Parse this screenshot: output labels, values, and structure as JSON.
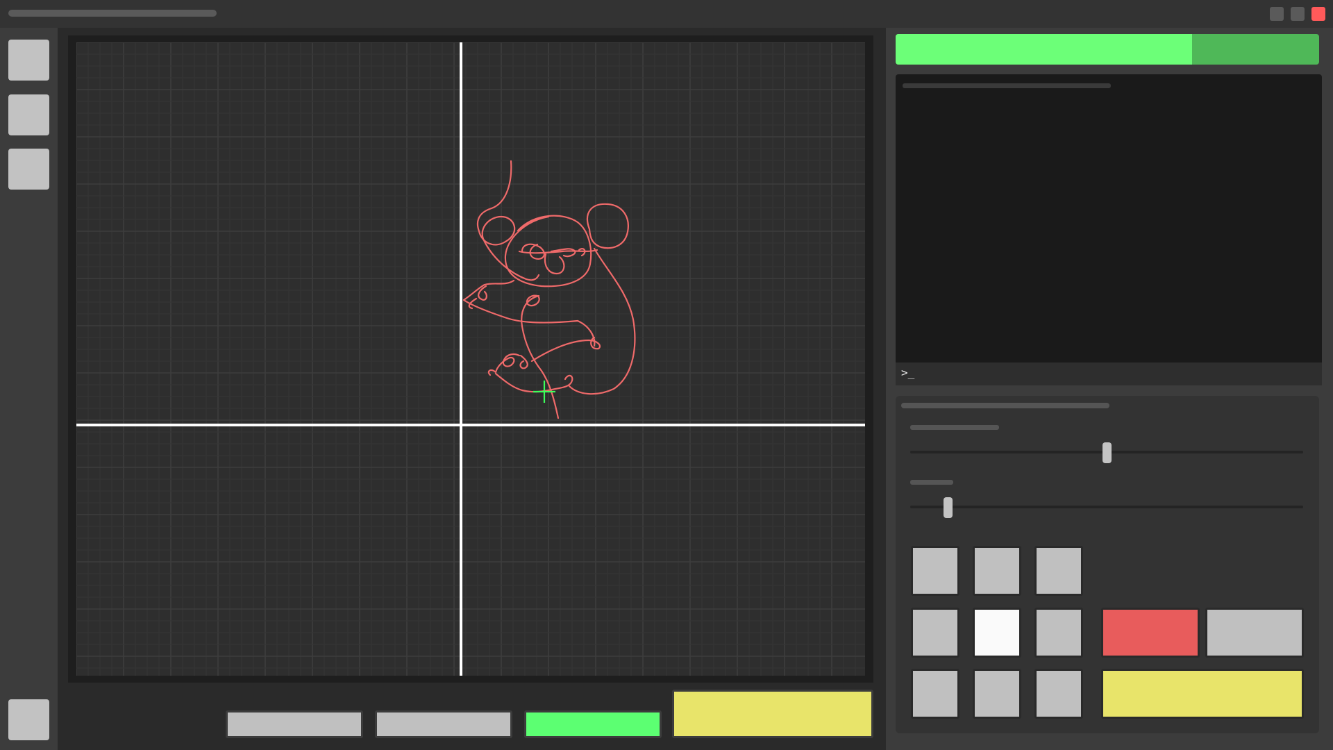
{
  "titlebar": {
    "close_color": "#ff5a5a"
  },
  "toolbar": {
    "tools": [
      "tool-1",
      "tool-2",
      "tool-3",
      "tool-bottom"
    ]
  },
  "canvas": {
    "background": "#2e2e2e",
    "axis_color": "#ffffff",
    "stroke_color": "#ef6a6a",
    "cursor_color": "#3cff5a",
    "drawing_subject": "koala-outline"
  },
  "progress": {
    "value": 0.7,
    "fill_color": "#6cff78",
    "track_color": "#4fb858"
  },
  "console": {
    "prompt": ">_"
  },
  "settings": {
    "slider_1": {
      "value": 0.5
    },
    "slider_2": {
      "value": 0.095
    }
  },
  "colors": {
    "button_gray": "#c0c0c0",
    "button_green": "#5cff72",
    "button_yellow": "#e8e46a",
    "button_red": "#e85c5c",
    "button_white": "#fafafa"
  }
}
